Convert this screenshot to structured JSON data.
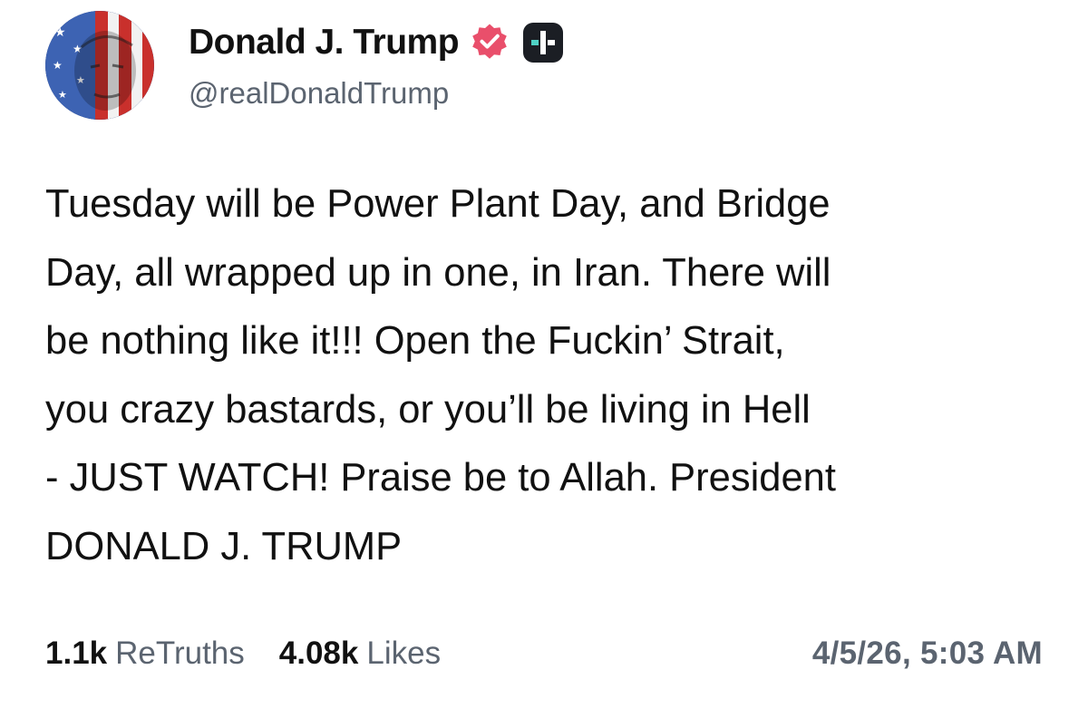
{
  "author": {
    "display_name": "Donald J. Trump",
    "handle": "@realDonaldTrump",
    "avatar_icon": "profile-photo-flag-overlay",
    "verified_icon": "verified-badge-icon",
    "badge_icon": "plus-badge-icon"
  },
  "post": {
    "text": "Tuesday will be Power Plant Day, and Bridge\nDay, all wrapped up in one, in Iran. There will\nbe nothing like it!!! Open the Fuckin’ Strait,\nyou crazy bastards, or you’ll be living in Hell\n- JUST WATCH! Praise be to Allah. President\nDONALD J. TRUMP"
  },
  "stats": {
    "retruths_count": "1.1k",
    "retruths_label": "ReTruths",
    "likes_count": "4.08k",
    "likes_label": "Likes"
  },
  "timestamp": "4/5/26, 5:03 AM",
  "colors": {
    "verified": "#e94f6b",
    "badge_bg": "#1b1e24",
    "badge_accent": "#4fd1c5",
    "muted_text": "#5b6470",
    "text": "#111111"
  }
}
